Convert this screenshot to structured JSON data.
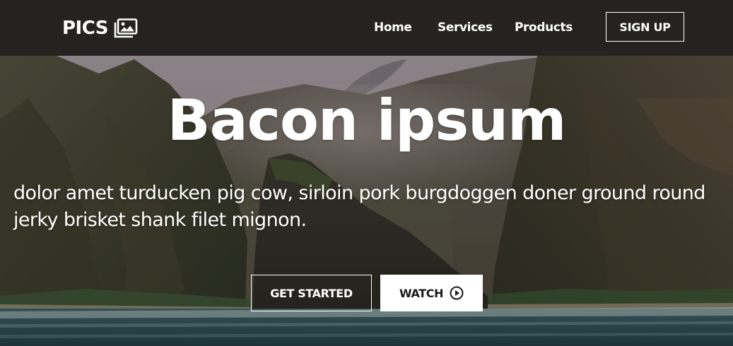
{
  "navbar": {
    "logo_text": "PICS",
    "logo_icon": "images-icon",
    "links": [
      {
        "label": "Home"
      },
      {
        "label": "Services"
      },
      {
        "label": "Products"
      }
    ],
    "signup_label": "SIGN UP"
  },
  "hero": {
    "title": "Bacon ipsum",
    "subtitle": "dolor amet turducken pig cow, sirloin pork burgdoggen doner ground round jerky brisket shank filet mignon.",
    "get_started_label": "GET STARTED",
    "watch_label": "WATCH",
    "watch_icon": "play-circle-icon",
    "background": "coastal-cliffs-photo"
  },
  "colors": {
    "navbar_bg": "#262222",
    "text": "#ffffff",
    "watch_bg": "#ffffff",
    "watch_text": "#1b1b1b"
  }
}
